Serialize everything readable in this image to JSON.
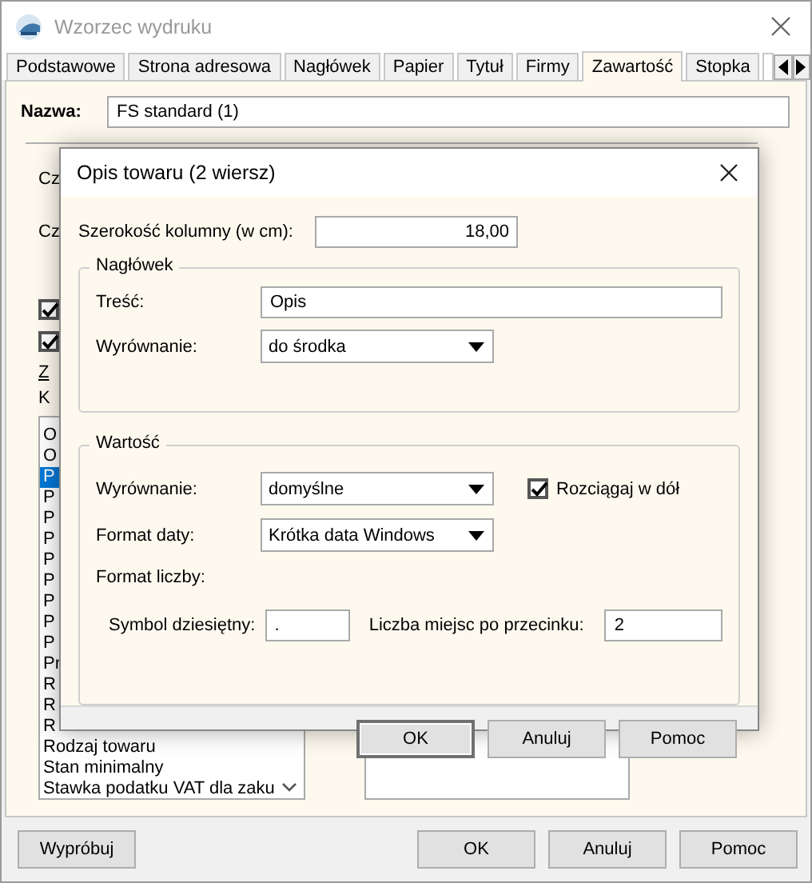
{
  "window": {
    "title": "Wzorzec wydruku"
  },
  "tabs": [
    {
      "label": "Podstawowe",
      "selected": false
    },
    {
      "label": "Strona adresowa",
      "selected": false
    },
    {
      "label": "Nagłówek",
      "selected": false
    },
    {
      "label": "Papier",
      "selected": false
    },
    {
      "label": "Tytuł",
      "selected": false
    },
    {
      "label": "Firmy",
      "selected": false
    },
    {
      "label": "Zawartość",
      "selected": true
    },
    {
      "label": "Stopka",
      "selected": false
    }
  ],
  "name_field": {
    "label": "Nazwa:",
    "value": "FS standard (1)"
  },
  "background": {
    "labels": [
      "Cz",
      "Cz"
    ],
    "checkboxes": [
      {
        "checked": true
      },
      {
        "checked": true
      }
    ],
    "link": "Z",
    "list_label": "K",
    "list_items": [
      {
        "text": "O",
        "selected": false
      },
      {
        "text": "O",
        "selected": false
      },
      {
        "text": "P",
        "selected": true
      },
      {
        "text": "P",
        "selected": false
      },
      {
        "text": "P",
        "selected": false
      },
      {
        "text": "P",
        "selected": false
      },
      {
        "text": "P",
        "selected": false
      },
      {
        "text": "P",
        "selected": false
      },
      {
        "text": "P",
        "selected": false
      },
      {
        "text": "P",
        "selected": false
      },
      {
        "text": "P",
        "selected": false
      },
      {
        "text": "Pr",
        "selected": false
      },
      {
        "text": "R",
        "selected": false
      },
      {
        "text": "R",
        "selected": false
      },
      {
        "text": "R",
        "selected": false
      },
      {
        "text": "Rodzaj towaru",
        "selected": false
      },
      {
        "text": "Stan minimalny",
        "selected": false
      },
      {
        "text": "Stawka podatku VAT dla zaku",
        "selected": false
      }
    ]
  },
  "footer": {
    "left_button": "Wypróbuj",
    "buttons": [
      "OK",
      "Anuluj",
      "Pomoc"
    ]
  },
  "dialog": {
    "title": "Opis towaru (2 wiersz)",
    "width_label": "Szerokość kolumny (w cm):",
    "width_value": "18,00",
    "header_group": {
      "title": "Nagłówek",
      "content_label": "Treść:",
      "content_value": "Opis",
      "align_label": "Wyrównanie:",
      "align_value": "do środka"
    },
    "value_group": {
      "title": "Wartość",
      "align_label": "Wyrównanie:",
      "align_value": "domyślne",
      "stretch": {
        "label": "Rozciągaj w dół",
        "checked": true
      },
      "date_label": "Format daty:",
      "date_value": "Krótka data Windows",
      "number_label": "Format liczby:",
      "decimal_label": "Symbol dziesiętny:",
      "decimal_value": ".",
      "places_label": "Liczba miejsc po przecinku:",
      "places_value": "2"
    },
    "buttons": [
      {
        "label": "OK",
        "default": true
      },
      {
        "label": "Anuluj",
        "default": false
      },
      {
        "label": "Pomoc",
        "default": false
      }
    ]
  }
}
